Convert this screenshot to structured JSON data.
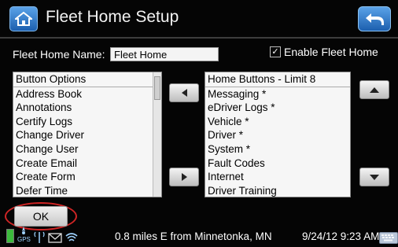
{
  "header": {
    "title": "Fleet Home Setup",
    "home_icon": "home-icon",
    "back_icon": "back-arrow-icon",
    "accent_color": "#2f7fd0"
  },
  "form": {
    "name_label": "Fleet Home Name:",
    "name_value": "Fleet Home",
    "enable_label": "Enable Fleet Home",
    "enable_checked": true,
    "check_mark": "✓"
  },
  "button_options": {
    "header": "Button Options",
    "items": [
      "Address Book",
      "Annotations",
      "Certify Logs",
      "Change Driver",
      "Change User",
      "Create Email",
      "Create Form",
      "Defer Time"
    ]
  },
  "home_buttons": {
    "header": "Home Buttons - Limit 8",
    "items": [
      "Messaging *",
      "eDriver Logs *",
      "Vehicle *",
      "Driver *",
      "System *",
      "Fault Codes",
      "Internet",
      "Driver Training"
    ]
  },
  "ok_label": "OK",
  "status_bar": {
    "location": "0.8 miles E from Minnetonka, MN",
    "datetime": "9/24/12 9:23 AM",
    "gps_label": "GPS",
    "icons": [
      "battery-icon",
      "gps-icon",
      "cell-signal-icon",
      "mail-icon",
      "wifi-icon",
      "keyboard-icon"
    ],
    "highlight_color": "#d02525"
  }
}
